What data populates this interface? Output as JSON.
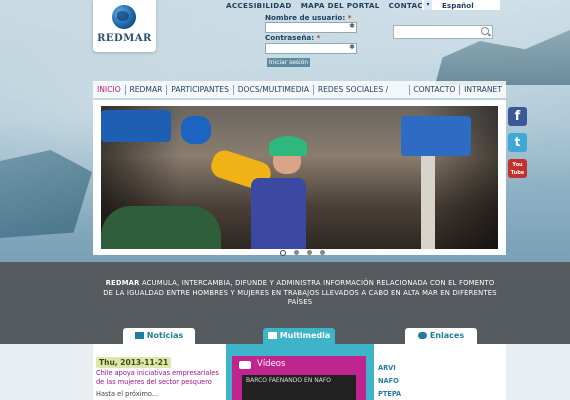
{
  "logo": {
    "text": "REDMAR"
  },
  "top_nav": [
    "ACCESIBILIDAD",
    "MAPA DEL PORTAL",
    "CONTACTA"
  ],
  "language": {
    "selected": "Español"
  },
  "login": {
    "username_label": "Nombre de usuario:",
    "password_label": "Contraseña:",
    "required_mark": "*",
    "button": "Iniciar sesión"
  },
  "main_nav": [
    {
      "label": "INICIO",
      "active": true
    },
    {
      "label": "REDMAR",
      "dropdown": true
    },
    {
      "label": "PARTICIPANTES"
    },
    {
      "label": "DOCS/MULTIMEDIA"
    },
    {
      "label": "REDES SOCIALES / EVENTOS"
    },
    {
      "label": "CONTACTO"
    },
    {
      "label": "INTRANET"
    }
  ],
  "social": [
    {
      "icon": "facebook-icon",
      "glyph": "f",
      "color": "#3b5998"
    },
    {
      "icon": "twitter-icon",
      "glyph": "t",
      "color": "#3fa9d6"
    },
    {
      "icon": "youtube-icon",
      "glyph": "You Tube",
      "color": "#c4302b"
    }
  ],
  "slider": {
    "dots": 4,
    "active_dot": 0
  },
  "tagline": {
    "brand": "REDMAR",
    "text": " ACUMULA, INTERCAMBIA, DIFUNDE Y ADMINISTRA INFORMACIÓN RELACIONADA CON EL FOMENTO DE LA IGUALDAD ENTRE HOMBRES Y MUJERES EN TRABAJOS LLEVADOS A CABO EN ALTA MAR EN DIFERENTES PAÍSES"
  },
  "tabs": {
    "news": "Noticias",
    "multimedia": "Multimedia",
    "links": "Enlaces"
  },
  "news": {
    "date": "Thu, 2013-11-21",
    "headline": "Chile apoya iniciativas empresariales de las mujeres del sector pesquero",
    "snippet": "Hasta el próximo..."
  },
  "multimedia": {
    "videos_title": "Vídeos",
    "video_caption": "BARCO FAENANDO EN NAFO"
  },
  "links": [
    "ARVI",
    "NAFO",
    "PTEPA"
  ]
}
